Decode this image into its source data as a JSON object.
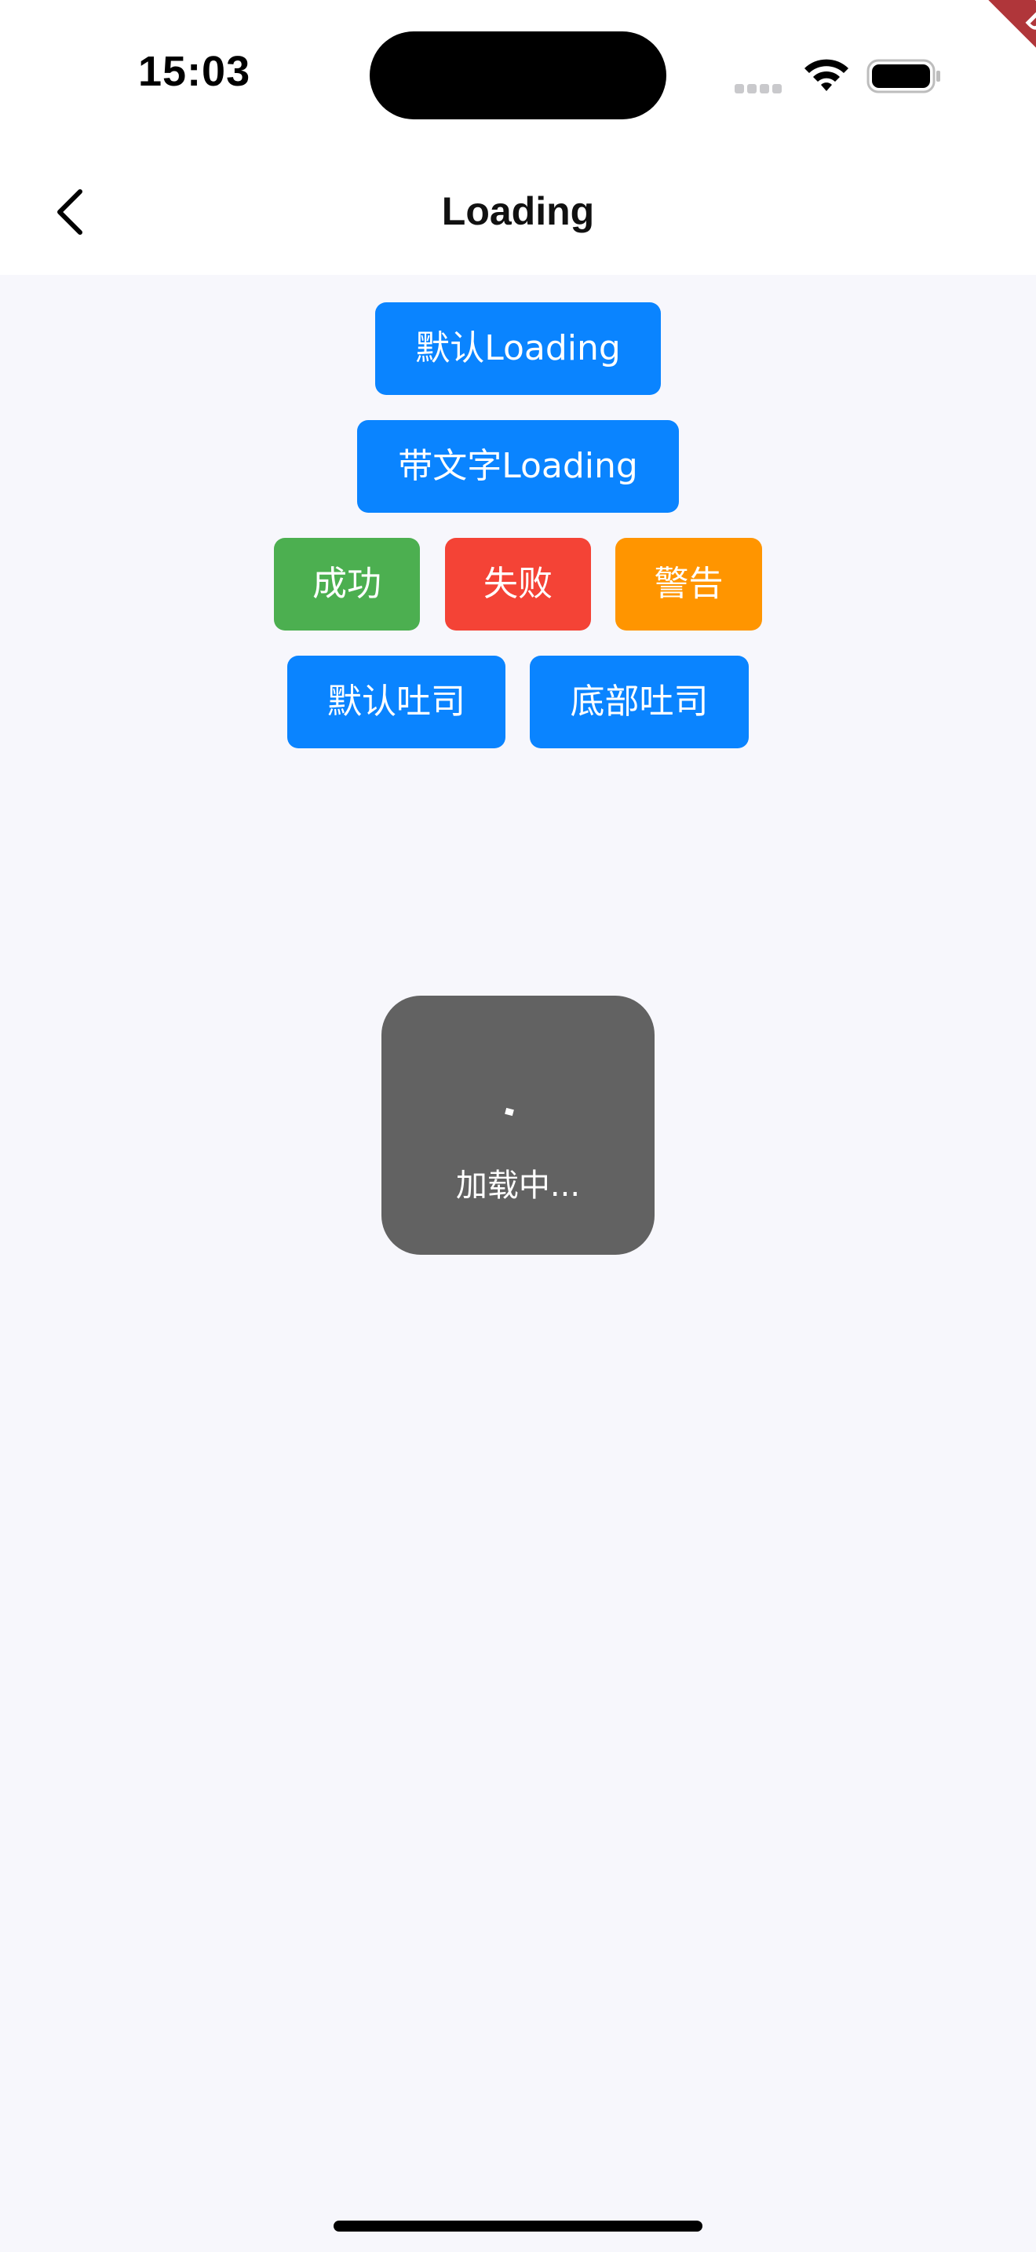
{
  "status_bar": {
    "time": "15:03",
    "wifi_icon": "wifi-icon",
    "battery_icon": "battery-icon",
    "signal_icon": "cellular-signal-icon"
  },
  "debug_banner": {
    "label": "DEBUG",
    "color": "#b0363a"
  },
  "nav": {
    "back_icon": "chevron-left-icon",
    "title": "Loading"
  },
  "buttons": {
    "default_loading": "默认Loading",
    "text_loading": "带文字Loading",
    "success": "成功",
    "fail": "失败",
    "warning": "警告",
    "default_toast": "默认吐司",
    "bottom_toast": "底部吐司"
  },
  "colors": {
    "primary": "#0a84ff",
    "success": "#4caf50",
    "danger": "#f44336",
    "warning": "#ff9500",
    "background": "#f7f7fc",
    "toast": "#626262"
  },
  "toast": {
    "spinner_icon": "loading-spinner-icon",
    "text": "加载中..."
  }
}
